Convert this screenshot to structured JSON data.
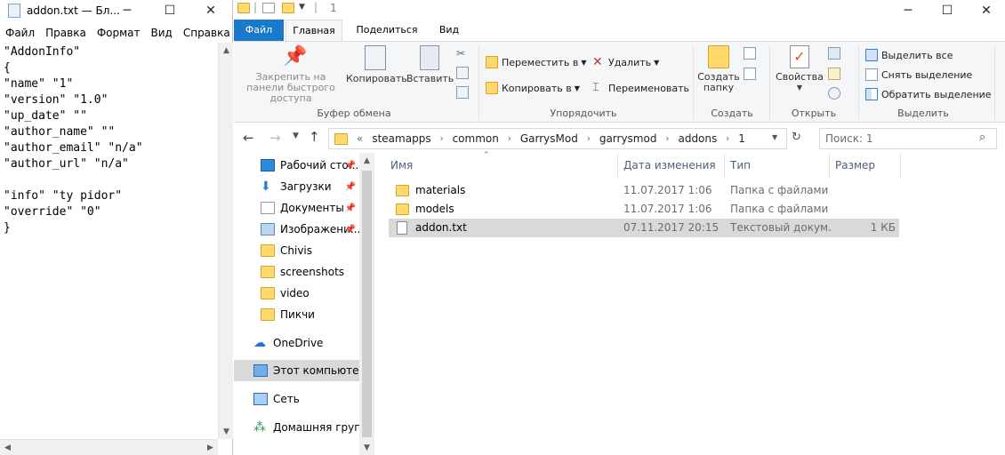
{
  "notepad": {
    "title": "addon.txt — Бл...",
    "menu": [
      "Файл",
      "Правка",
      "Формат",
      "Вид",
      "Справка"
    ],
    "content": "\"AddonInfo\"\n{\n\"name\" \"1\"\n\"version\" \"1.0\"\n\"up_date\" \"\"\n\"author_name\" \"\"\n\"author_email\" \"n/a\"\n\"author_url\" \"n/a\"\n\n\"info\" \"ty pidor\"\n\"override\" \"0\"\n}",
    "caption": {
      "minimize": "─",
      "maximize": "☐",
      "close": "✕"
    }
  },
  "explorer": {
    "title": "1",
    "caption": {
      "minimize": "─",
      "maximize": "☐",
      "close": "✕"
    },
    "tabs": [
      "Файл",
      "Главная",
      "Поделиться",
      "Вид"
    ],
    "ribbon": {
      "clipboard": {
        "pin": "Закрепить на панели быстрого доступа",
        "copy": "Копировать",
        "paste": "Вставить",
        "label": "Буфер обмена"
      },
      "organize": {
        "move": "Переместить в",
        "copyto": "Копировать в",
        "delete": "Удалить",
        "rename": "Переименовать",
        "label": "Упорядочить"
      },
      "create": {
        "newfolder": "Создать папку",
        "label": "Создать"
      },
      "open": {
        "properties": "Свойства",
        "label": "Открыть"
      },
      "select": {
        "all": "Выделить все",
        "none": "Снять выделение",
        "invert": "Обратить выделение",
        "label": "Выделить"
      }
    },
    "address": {
      "overflow": "«",
      "crumbs": [
        "steamapps",
        "common",
        "GarrysMod",
        "garrysmod",
        "addons",
        "1"
      ],
      "search_placeholder": "Поиск: 1"
    },
    "nav": [
      {
        "label": "Рабочий сто...",
        "icon": "desktop-icon",
        "pinned": true
      },
      {
        "label": "Загрузки",
        "icon": "downloads-icon",
        "pinned": true
      },
      {
        "label": "Документы",
        "icon": "documents-icon",
        "pinned": true
      },
      {
        "label": "Изображени...",
        "icon": "pictures-icon",
        "pinned": true
      },
      {
        "label": "Chivis",
        "icon": "folder-icon",
        "pinned": false
      },
      {
        "label": "screenshots",
        "icon": "folder-icon",
        "pinned": false
      },
      {
        "label": "video",
        "icon": "folder-icon",
        "pinned": false
      },
      {
        "label": "Пикчи",
        "icon": "folder-icon",
        "pinned": false
      },
      {
        "label": "OneDrive",
        "icon": "onedrive-icon",
        "pinned": false
      },
      {
        "label": "Этот компьютер",
        "icon": "computer-icon",
        "pinned": false
      },
      {
        "label": "Сеть",
        "icon": "network-icon",
        "pinned": false
      },
      {
        "label": "Домашняя групп...",
        "icon": "homegroup-icon",
        "pinned": false
      }
    ],
    "columns": [
      "Имя",
      "Дата изменения",
      "Тип",
      "Размер"
    ],
    "files": [
      {
        "name": "materials",
        "date": "11.07.2017 1:06",
        "type": "Папка с файлами",
        "size": "",
        "icon": "folder-icon"
      },
      {
        "name": "models",
        "date": "11.07.2017 1:06",
        "type": "Папка с файлами",
        "size": "",
        "icon": "folder-icon"
      },
      {
        "name": "addon.txt",
        "date": "07.11.2017 20:15",
        "type": "Текстовый докум...",
        "size": "1 КБ",
        "icon": "text-file-icon"
      }
    ],
    "colors": {
      "accent": "#1979ca",
      "selection": "#d9d9d9",
      "folder": "#ffd86e"
    }
  }
}
